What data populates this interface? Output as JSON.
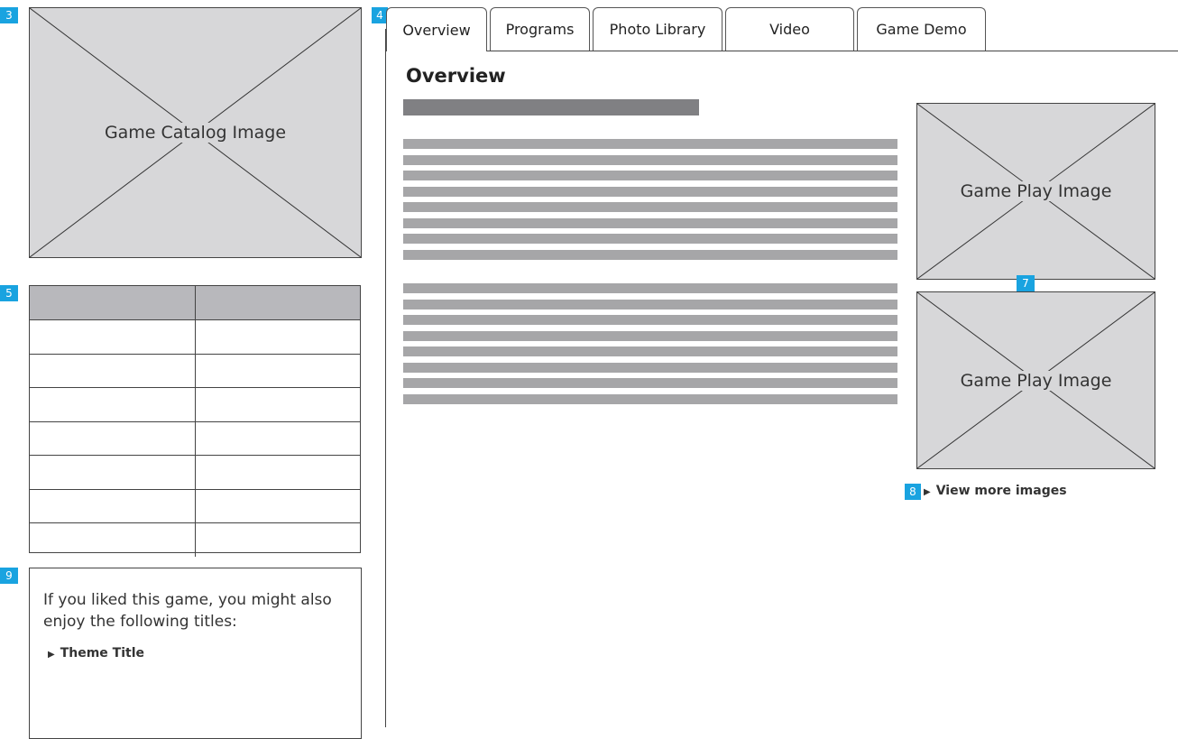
{
  "badges": {
    "catalog_image": "3",
    "tabs": "4",
    "info_table": "5",
    "gameplay_images": "7",
    "view_more": "8",
    "recommendations": "9"
  },
  "catalog_image": {
    "label": "Game Catalog Image"
  },
  "info_table": {
    "columns": [
      "",
      ""
    ],
    "rows": [
      [
        "",
        ""
      ],
      [
        "",
        ""
      ],
      [
        "",
        ""
      ],
      [
        "",
        ""
      ],
      [
        "",
        ""
      ],
      [
        "",
        ""
      ],
      [
        "",
        ""
      ]
    ]
  },
  "recommendations": {
    "text": "If you liked this game, you might also enjoy the following titles:",
    "link_label": "Theme Title"
  },
  "tabs": [
    {
      "label": "Overview",
      "active": true
    },
    {
      "label": "Programs",
      "active": false
    },
    {
      "label": "Photo Library",
      "active": false
    },
    {
      "label": "Video",
      "active": false
    },
    {
      "label": "Game Demo",
      "active": false
    }
  ],
  "overview": {
    "heading": "Overview",
    "subtitle_bar_color": "#808083",
    "text_line_color": "#a6a6a8",
    "paragraph1_line_count": 8,
    "paragraph2_line_count": 8
  },
  "gameplay_images": [
    {
      "label": "Game Play Image"
    },
    {
      "label": "Game Play Image"
    }
  ],
  "view_more": {
    "label": "View more images"
  },
  "colors": {
    "badge": "#19a3e0",
    "placeholder": "#d7d7d9",
    "table_header": "#b8b8bc"
  }
}
